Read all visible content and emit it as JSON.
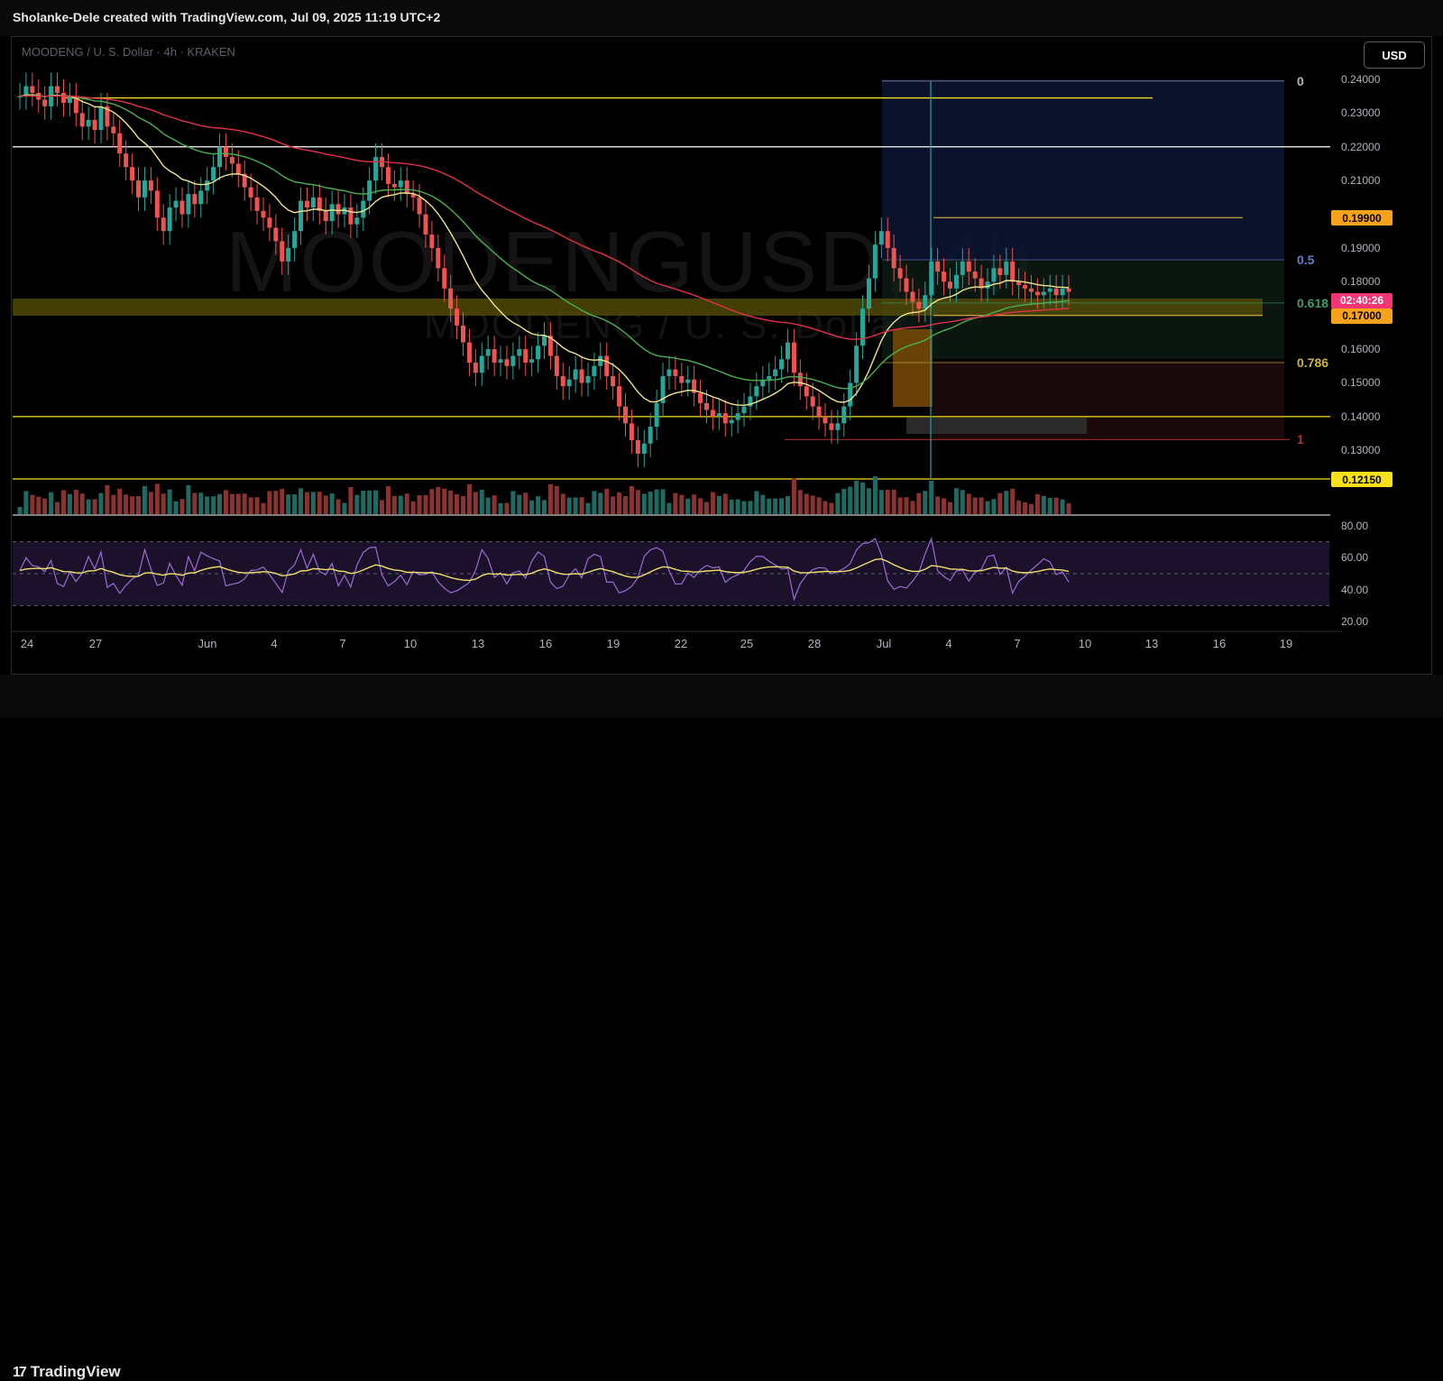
{
  "header": {
    "credit": "Sholanke-Dele created with TradingView.com, Jul 09, 2025 11:19 UTC+2"
  },
  "legend": "MOODENG / U. S. Dollar · 4h · KRAKEN",
  "watermark": {
    "line1": "MOODENGUSD, 4h",
    "line2": "MOODENG / U. S. Dollar"
  },
  "currency_button": "USD",
  "footer": {
    "brand": "TradingView",
    "logo_glyph": "17"
  },
  "price_axis": [
    "0.24000",
    "0.23000",
    "0.22000",
    "0.21000",
    "0.20000",
    "0.19000",
    "0.18000",
    "0.16000",
    "0.15000",
    "0.14000",
    "0.13000"
  ],
  "price_tags": [
    {
      "id": "high",
      "text": "0.19900",
      "price": 0.199,
      "bg": "#f7a21b",
      "fg": "#000000"
    },
    {
      "id": "countdown",
      "text": "02:40:26",
      "price": 0.1745,
      "bg": "#f23674",
      "fg": "#ffffff"
    },
    {
      "id": "support",
      "text": "0.17000",
      "price": 0.17,
      "bg": "#f7a21b",
      "fg": "#000000"
    },
    {
      "id": "low",
      "text": "0.12150",
      "price": 0.1215,
      "bg": "#f5e01e",
      "fg": "#000000"
    }
  ],
  "fib_levels": [
    {
      "label": "0",
      "price": 0.2395,
      "color": "#b2b5be"
    },
    {
      "label": "0.5",
      "price": 0.1865,
      "color": "#5b7fce"
    },
    {
      "label": "0.618",
      "price": 0.1737,
      "color": "#3c9e6a"
    },
    {
      "label": "0.786",
      "price": 0.156,
      "color": "#c8b43c"
    },
    {
      "label": "1",
      "price": 0.1332,
      "color": "#b23232"
    }
  ],
  "date_axis": [
    "24",
    "27",
    "Jun",
    "4",
    "7",
    "10",
    "13",
    "16",
    "19",
    "22",
    "25",
    "28",
    "Jul",
    "4",
    "7",
    "10",
    "13",
    "16",
    "19"
  ],
  "colors": {
    "up": "#26a69a",
    "down": "#ef5350",
    "ema_fast": "#f0e68c",
    "ema_mid": "#4caf50",
    "ema_slow": "#e0314a",
    "rsi": "#9c6bd6",
    "rsi_ma": "#f0e06a",
    "hline": "#ffffff",
    "yellow": "#f5e01e"
  },
  "chart_data": {
    "type": "candlestick",
    "symbol": "MOODENG / U. S. Dollar",
    "interval": "4h",
    "exchange": "KRAKEN",
    "ylim": [
      0.118,
      0.243
    ],
    "horizontal_levels": [
      0.2345,
      0.22,
      0.14,
      0.1215
    ],
    "trend_levels": [
      0.199,
      0.17,
      0.1332
    ],
    "close_series": [
      0.235,
      0.238,
      0.236,
      0.234,
      0.232,
      0.238,
      0.236,
      0.233,
      0.235,
      0.23,
      0.226,
      0.228,
      0.225,
      0.232,
      0.226,
      0.224,
      0.218,
      0.214,
      0.21,
      0.205,
      0.21,
      0.207,
      0.199,
      0.195,
      0.202,
      0.204,
      0.2,
      0.206,
      0.203,
      0.207,
      0.21,
      0.214,
      0.22,
      0.217,
      0.215,
      0.212,
      0.208,
      0.205,
      0.201,
      0.199,
      0.196,
      0.192,
      0.186,
      0.19,
      0.195,
      0.204,
      0.202,
      0.205,
      0.201,
      0.198,
      0.203,
      0.2,
      0.202,
      0.197,
      0.199,
      0.204,
      0.21,
      0.217,
      0.214,
      0.209,
      0.208,
      0.21,
      0.206,
      0.205,
      0.2,
      0.194,
      0.19,
      0.184,
      0.178,
      0.172,
      0.167,
      0.162,
      0.156,
      0.153,
      0.158,
      0.16,
      0.156,
      0.157,
      0.155,
      0.158,
      0.16,
      0.156,
      0.157,
      0.161,
      0.164,
      0.158,
      0.152,
      0.149,
      0.151,
      0.154,
      0.15,
      0.152,
      0.155,
      0.158,
      0.152,
      0.149,
      0.143,
      0.138,
      0.133,
      0.129,
      0.132,
      0.137,
      0.144,
      0.152,
      0.154,
      0.152,
      0.15,
      0.151,
      0.147,
      0.144,
      0.142,
      0.14,
      0.141,
      0.138,
      0.139,
      0.141,
      0.143,
      0.146,
      0.149,
      0.151,
      0.152,
      0.154,
      0.157,
      0.162,
      0.153,
      0.149,
      0.146,
      0.143,
      0.14,
      0.138,
      0.136,
      0.138,
      0.143,
      0.15,
      0.161,
      0.172,
      0.181,
      0.191,
      0.195,
      0.19,
      0.184,
      0.181,
      0.177,
      0.174,
      0.172,
      0.176,
      0.186,
      0.183,
      0.18,
      0.178,
      0.182,
      0.186,
      0.183,
      0.181,
      0.178,
      0.18,
      0.184,
      0.182,
      0.186,
      0.18,
      0.179,
      0.178,
      0.177,
      0.176,
      0.177,
      0.178,
      0.176,
      0.178,
      0.177
    ],
    "ema_fast_end": 0.1785,
    "ema_mid_end": 0.1725,
    "ema_slow_end": 0.1665,
    "volume_panel": true,
    "rsi": {
      "ylim": [
        20,
        80
      ],
      "ticks": [
        "80.00",
        "60.00",
        "40.00",
        "20.00"
      ],
      "upper": 70,
      "mid": 50,
      "lower": 30
    }
  }
}
